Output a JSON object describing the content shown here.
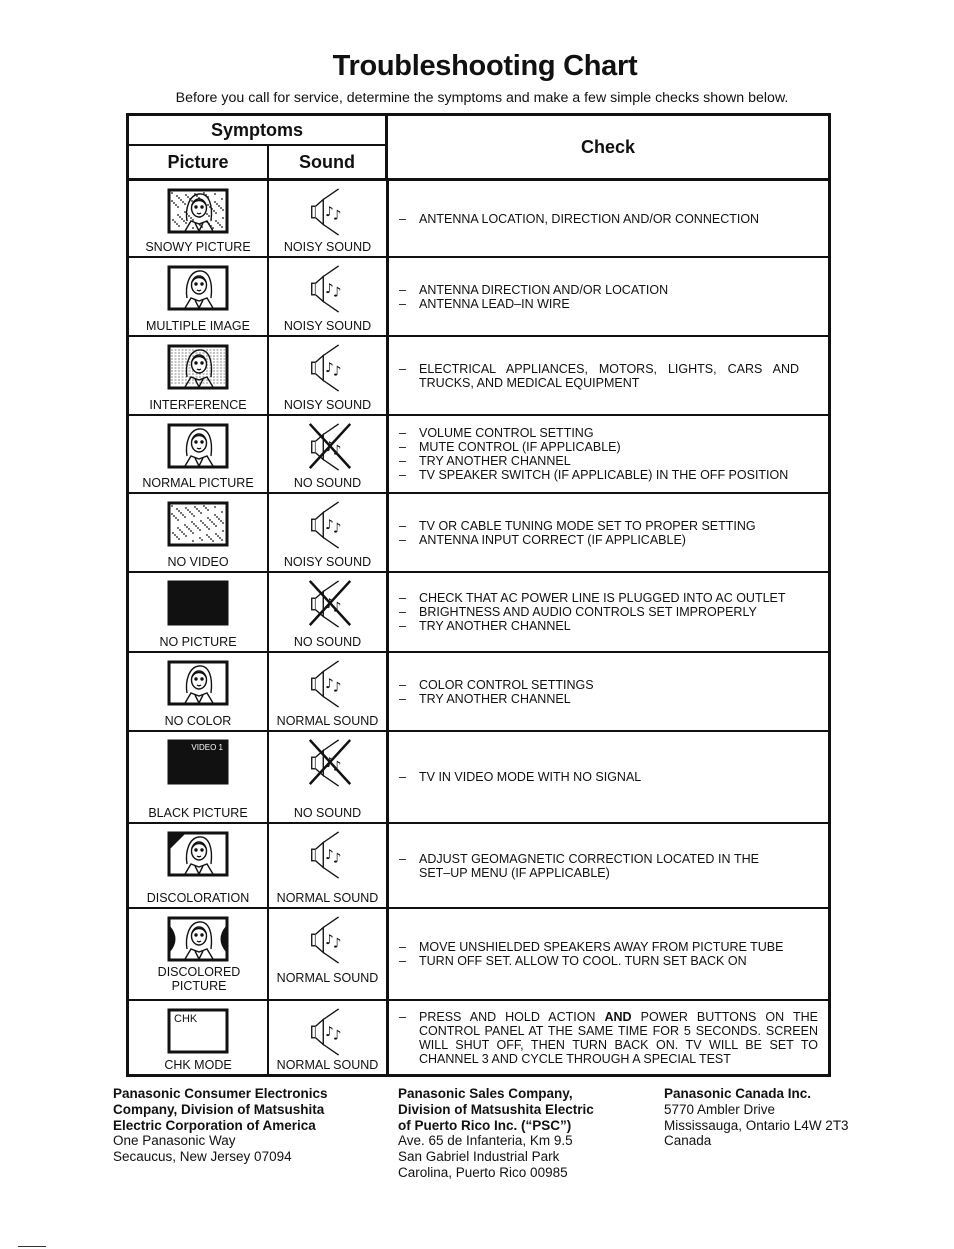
{
  "title": "Troubleshooting Chart",
  "subtitle": "Before you call for service, determine the symptoms and make a few simple checks shown below.",
  "table": {
    "headers": {
      "symptoms": "Symptoms",
      "picture": "Picture",
      "sound": "Sound",
      "check": "Check"
    },
    "rows": [
      {
        "picture": "SNOWY PICTURE",
        "picture_icon": "tv-snowy-picture-icon",
        "sound": "NOISY SOUND",
        "sound_icon": "speaker-noisy-icon",
        "checks": [
          "ANTENNA LOCATION, DIRECTION AND/OR CONNECTION"
        ]
      },
      {
        "picture": "MULTIPLE IMAGE",
        "picture_icon": "tv-multiple-image-icon",
        "sound": "NOISY SOUND",
        "sound_icon": "speaker-noisy-icon",
        "checks": [
          "ANTENNA DIRECTION AND/OR LOCATION",
          "ANTENNA LEAD–IN WIRE"
        ]
      },
      {
        "picture": "INTERFERENCE",
        "picture_icon": "tv-interference-icon",
        "sound": "NOISY SOUND",
        "sound_icon": "speaker-noisy-icon",
        "checks": [
          "ELECTRICAL APPLIANCES, MOTORS, LIGHTS, CARS AND TRUCKS, AND MEDICAL EQUIPMENT"
        ]
      },
      {
        "picture": "NORMAL PICTURE",
        "picture_icon": "tv-normal-picture-icon",
        "sound": "NO SOUND",
        "sound_icon": "speaker-muted-icon",
        "checks": [
          "VOLUME CONTROL SETTING",
          "MUTE CONTROL (IF APPLICABLE)",
          "TRY ANOTHER CHANNEL",
          "TV SPEAKER SWITCH (IF APPLICABLE) IN THE OFF POSITION"
        ]
      },
      {
        "picture": "NO VIDEO",
        "picture_icon": "tv-no-video-icon",
        "sound": "NOISY SOUND",
        "sound_icon": "speaker-noisy-icon",
        "checks": [
          "TV OR CABLE TUNING MODE SET TO PROPER SETTING",
          "ANTENNA INPUT CORRECT (IF APPLICABLE)"
        ]
      },
      {
        "picture": "NO PICTURE",
        "picture_icon": "tv-no-picture-icon",
        "sound": "NO SOUND",
        "sound_icon": "speaker-muted-icon",
        "checks": [
          "CHECK THAT AC POWER LINE  IS PLUGGED  INTO AC OUTLET",
          "BRIGHTNESS AND AUDIO CONTROLS SET IMPROPERLY",
          "TRY ANOTHER CHANNEL"
        ]
      },
      {
        "picture": "NO COLOR",
        "picture_icon": "tv-no-color-icon",
        "sound": "NORMAL SOUND",
        "sound_icon": "speaker-normal-icon",
        "checks": [
          "COLOR CONTROL SETTINGS",
          "TRY ANOTHER CHANNEL"
        ]
      },
      {
        "picture": "BLACK PICTURE",
        "picture_icon": "tv-black-picture-icon",
        "picture_overlay": "VIDEO 1",
        "sound": "NO SOUND",
        "sound_icon": "speaker-muted-icon",
        "checks": [
          "TV IN VIDEO MODE WITH NO SIGNAL"
        ]
      },
      {
        "picture": "DISCOLORATION",
        "picture_icon": "tv-discoloration-icon",
        "sound": "NORMAL SOUND",
        "sound_icon": "speaker-normal-icon",
        "checks": [
          "ADJUST GEOMAGNETIC CORRECTION LOCATED IN THE SET–UP MENU (IF APPLICABLE)"
        ]
      },
      {
        "picture": "DISCOLORED PICTURE",
        "picture_icon": "tv-discolored-picture-icon",
        "sound": "NORMAL SOUND",
        "sound_icon": "speaker-normal-icon",
        "checks": [
          "MOVE UNSHIELDED SPEAKERS AWAY FROM PICTURE TUBE",
          "TURN OFF SET.  ALLOW TO COOL.  TURN SET BACK ON"
        ]
      },
      {
        "picture": "CHK MODE",
        "picture_icon": "tv-chk-mode-icon",
        "picture_overlay": "CHK",
        "sound": "NORMAL SOUND",
        "sound_icon": "speaker-normal-icon",
        "checks": [
          "PRESS AND HOLD ACTION AND POWER BUTTONS ON THE CONTROL PANEL AT THE SAME TIME FOR 5 SECONDS.  SCREEN WILL SHUT OFF, THEN TURN BACK ON.  TV WILL BE SET TO CHANNEL 3 AND CYCLE THROUGH A SPECIAL TEST"
        ]
      }
    ]
  },
  "footer": {
    "addresses": [
      {
        "bold_lines": [
          "Panasonic Consumer Electronics",
          "Company, Division of Matsushita",
          "Electric Corporation of America"
        ],
        "lines": [
          "One Panasonic Way",
          "Secaucus, New Jersey 07094"
        ]
      },
      {
        "bold_lines": [
          "Panasonic Sales Company,",
          "Division of Matsushita Electric",
          "of Puerto Rico Inc. (“PSC”)"
        ],
        "lines": [
          "Ave. 65 de Infanteria, Km 9.5",
          "San Gabriel Industrial Park",
          "Carolina, Puerto Rico 00985"
        ]
      },
      {
        "bold_lines": [
          "Panasonic Canada Inc."
        ],
        "lines": [
          "5770 Ambler Drive",
          "Mississauga, Ontario L4W 2T3",
          "Canada"
        ]
      }
    ]
  }
}
